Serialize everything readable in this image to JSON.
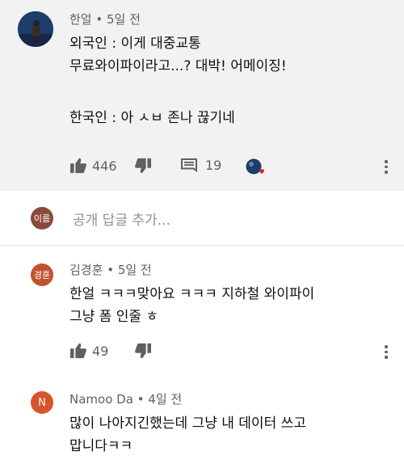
{
  "main_comment": {
    "author": "한얼",
    "time": "5일 전",
    "lines": [
      "외국인 : 이게 대중교통",
      "무료와이파이라고...? 대박! 어메이징!",
      "",
      "한국인 : 아 ㅅㅂ 존나 끊기네"
    ],
    "likes": "446",
    "replies": "19"
  },
  "reply_box": {
    "avatar_label": "이름",
    "placeholder": "공개 답글 추가..."
  },
  "replies": [
    {
      "avatar_label": "경훈",
      "avatar_color": "#c0522d",
      "author": "김경훈",
      "time": "5일 전",
      "lines": [
        "한얼 ㅋㅋㅋ맞아요 ㅋㅋㅋ 지하철 와이파이",
        "그냥 폼 인줄 ㅎ"
      ],
      "likes": "49"
    },
    {
      "avatar_label": "N",
      "avatar_color": "#d9532c",
      "author": "Namoo Da",
      "time": "4일 전",
      "lines": [
        "많이 나아지긴했는데 그냥 내 데이터 쓰고",
        "맙니다ㅋㅋ"
      ]
    }
  ],
  "colors": {
    "meta": "#606060",
    "panel": "#f2f2f2"
  }
}
